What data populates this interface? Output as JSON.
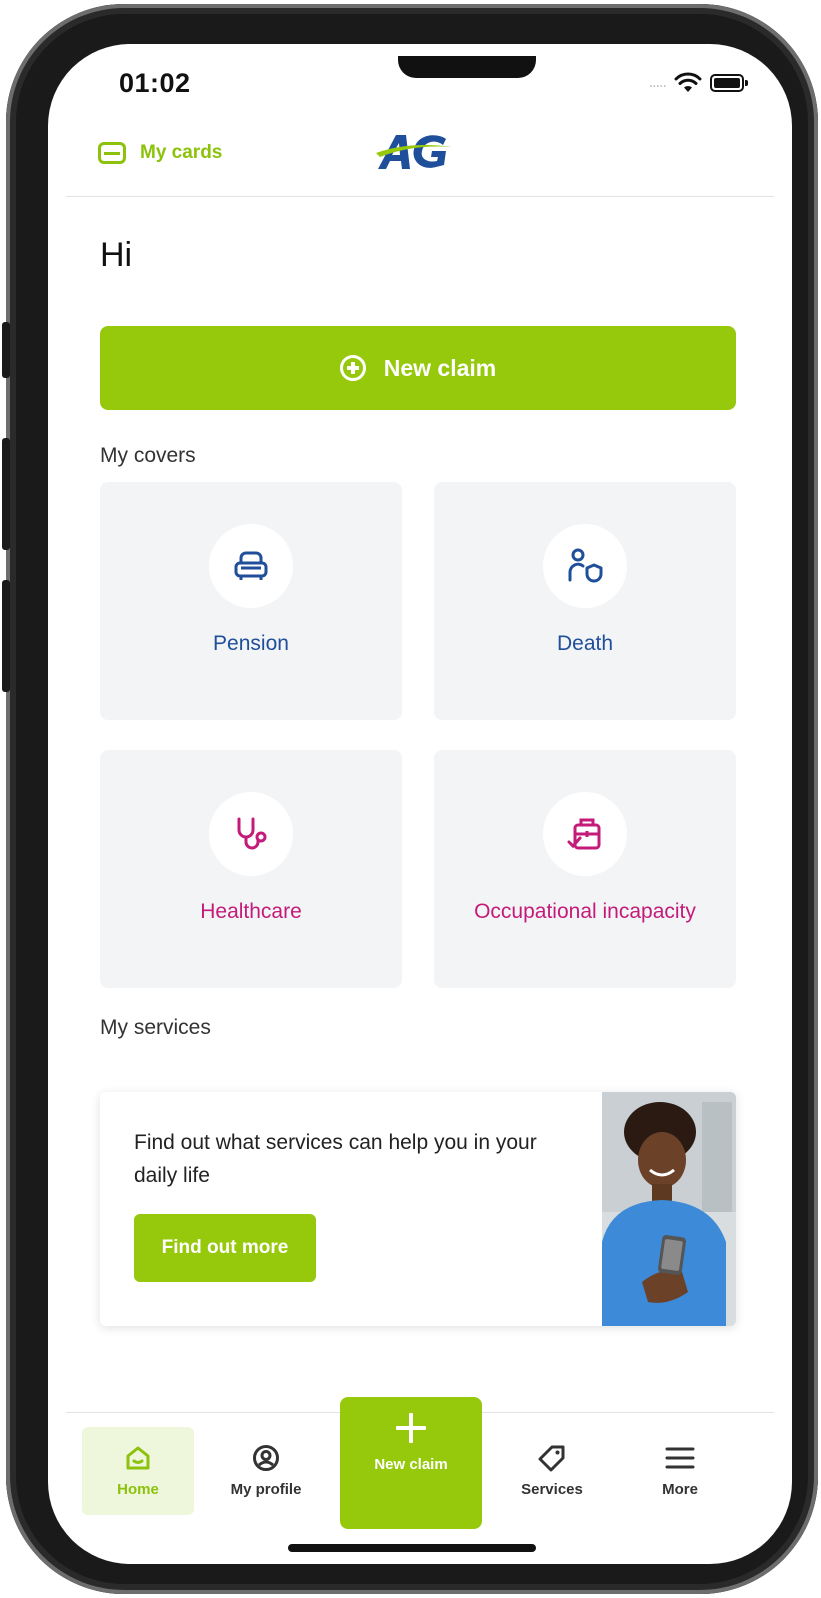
{
  "status_bar": {
    "time": "01:02",
    "signal_dots": "....."
  },
  "header": {
    "mycards_label": "My cards",
    "logo_text": "AG"
  },
  "greeting": "Hi",
  "new_claim_button": {
    "label": "New claim"
  },
  "covers": {
    "title": "My covers",
    "items": [
      {
        "label": "Pension",
        "icon": "armchair-icon",
        "color": "#1f4f9a"
      },
      {
        "label": "Death",
        "icon": "person-shield-icon",
        "color": "#1f4f9a"
      },
      {
        "label": "Healthcare",
        "icon": "stethoscope-icon",
        "color": "#c41b7a"
      },
      {
        "label": "Occupational incapacity",
        "icon": "briefcase-check-icon",
        "color": "#c41b7a"
      }
    ]
  },
  "services": {
    "title": "My services",
    "text": "Find out what services can help you in your daily life",
    "button_label": "Find out more"
  },
  "bottom_nav": {
    "home": "Home",
    "profile": "My profile",
    "new_claim": "New claim",
    "services": "Services",
    "more": "More"
  },
  "colors": {
    "brand_green": "#96c90c",
    "blue": "#1f4f9a",
    "pink": "#c41b7a"
  }
}
